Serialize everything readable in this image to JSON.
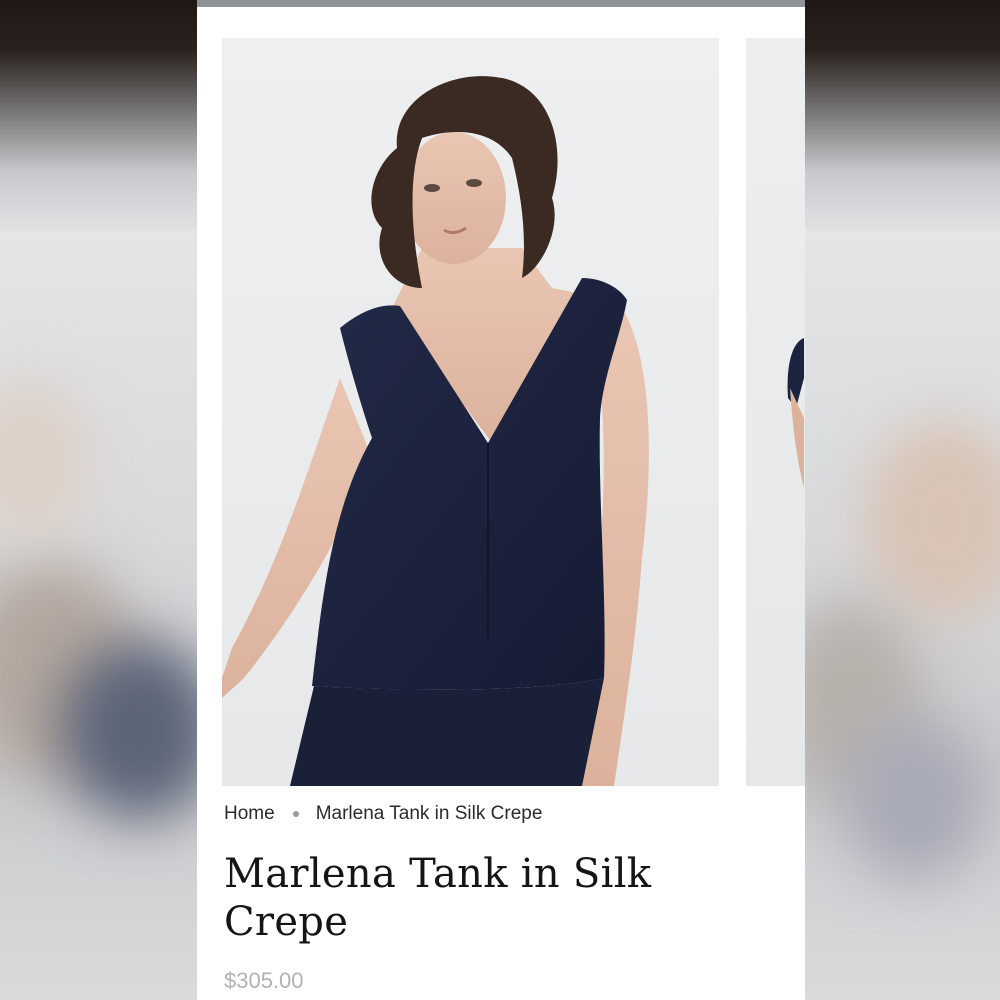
{
  "breadcrumb": {
    "home": "Home",
    "current": "Marlena Tank in Silk Crepe"
  },
  "product": {
    "title": "Marlena Tank in Silk Crepe",
    "price": "$305.00",
    "color": "#1c2340"
  },
  "gallery": {
    "slides": 2,
    "active": 1
  },
  "colors": {
    "page_background": "#ffffff",
    "top_bar": "#8d9397",
    "title_text": "#151515",
    "price_text": "#b2b2b2"
  }
}
